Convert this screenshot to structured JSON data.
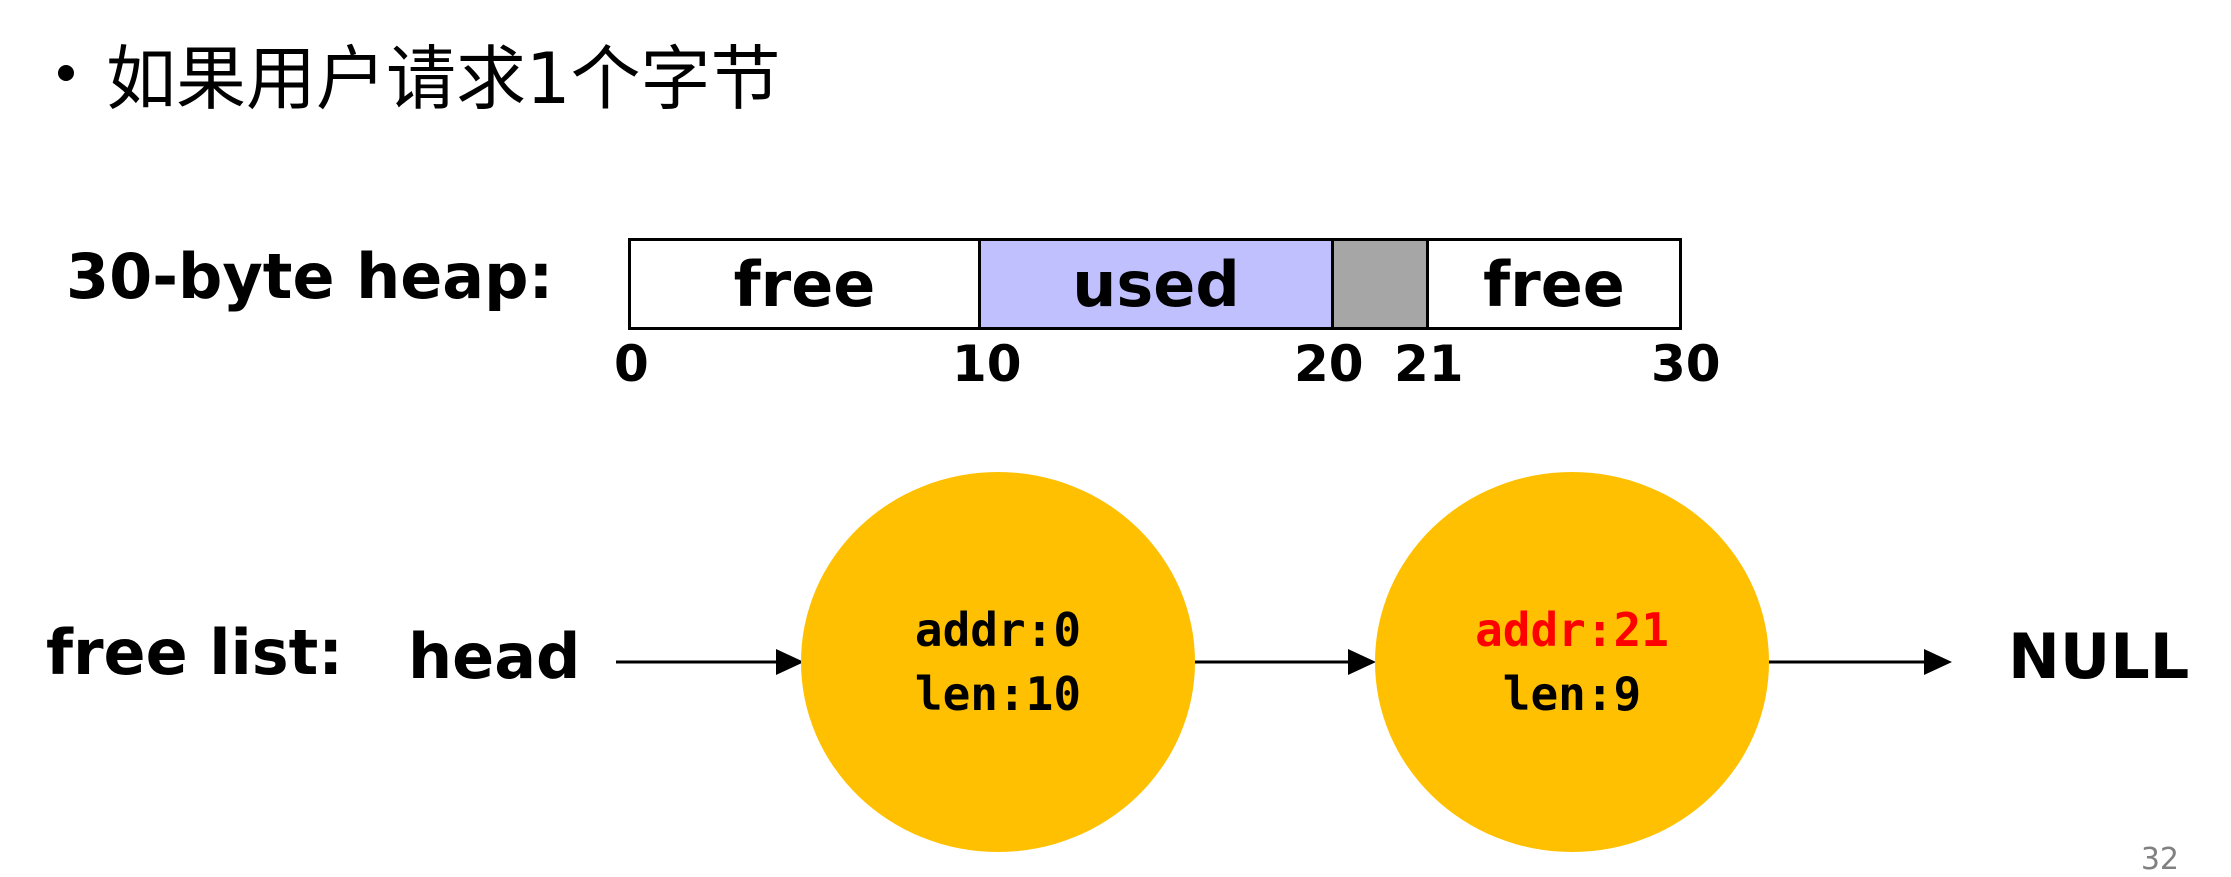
{
  "bullet": "如果用户请求1个字节",
  "heap": {
    "label": "30-byte heap:",
    "segments": [
      {
        "text": "free",
        "fill": "#ffffff"
      },
      {
        "text": "used",
        "fill": "#c0c0ff"
      },
      {
        "text": "",
        "fill": "#a6a6a6"
      },
      {
        "text": "free",
        "fill": "#ffffff"
      }
    ],
    "ticks": [
      "0",
      "10",
      "20",
      "21",
      "30"
    ]
  },
  "free_list": {
    "label": "free list:",
    "head": "head",
    "nodes": [
      {
        "addr": "addr:0",
        "len": "len:10",
        "addr_color": "#000000"
      },
      {
        "addr": "addr:21",
        "len": "len:9",
        "addr_color": "#ff0000"
      }
    ],
    "tail": "NULL",
    "node_color": "#fec000"
  },
  "page_number": "32"
}
